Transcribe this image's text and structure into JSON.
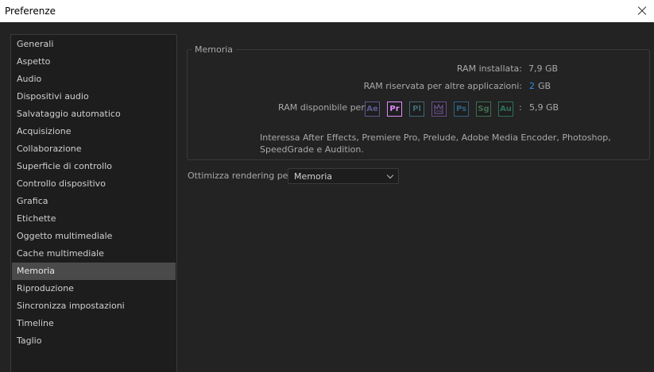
{
  "window": {
    "title": "Preferenze"
  },
  "sidebar": {
    "items": [
      {
        "label": "Generali",
        "active": false
      },
      {
        "label": "Aspetto",
        "active": false
      },
      {
        "label": "Audio",
        "active": false
      },
      {
        "label": "Dispositivi audio",
        "active": false
      },
      {
        "label": "Salvataggio automatico",
        "active": false
      },
      {
        "label": "Acquisizione",
        "active": false
      },
      {
        "label": "Collaborazione",
        "active": false
      },
      {
        "label": "Superficie di controllo",
        "active": false
      },
      {
        "label": "Controllo dispositivo",
        "active": false
      },
      {
        "label": "Grafica",
        "active": false
      },
      {
        "label": "Etichette",
        "active": false
      },
      {
        "label": "Oggetto multimediale",
        "active": false
      },
      {
        "label": "Cache multimediale",
        "active": false
      },
      {
        "label": "Memoria",
        "active": true
      },
      {
        "label": "Riproduzione",
        "active": false
      },
      {
        "label": "Sincronizza impostazioni",
        "active": false
      },
      {
        "label": "Timeline",
        "active": false
      },
      {
        "label": "Taglio",
        "active": false
      }
    ]
  },
  "memory": {
    "group_title": "Memoria",
    "installed_label": "RAM installata:",
    "installed_value": "7,9 GB",
    "reserved_label": "RAM riservata per altre applicazioni:",
    "reserved_value": "2",
    "reserved_unit": "GB",
    "available_label": "RAM disponibile per",
    "available_sep": ":",
    "available_value": "5,9 GB",
    "apps": [
      {
        "abbr": "Ae",
        "icon": "after-effects-icon",
        "color": "#5a5a8c"
      },
      {
        "abbr": "Pr",
        "icon": "premiere-pro-icon",
        "color": "#e18bff"
      },
      {
        "abbr": "Pl",
        "icon": "prelude-icon",
        "color": "#3f6a73"
      },
      {
        "abbr": "",
        "icon": "media-encoder-icon",
        "color": "#6b4f8c"
      },
      {
        "abbr": "Ps",
        "icon": "photoshop-icon",
        "color": "#2f6284"
      },
      {
        "abbr": "Sg",
        "icon": "speedgrade-icon",
        "color": "#3f6e52"
      },
      {
        "abbr": "Au",
        "icon": "audition-icon",
        "color": "#2f6f5b"
      }
    ],
    "description": "Interessa After Effects, Premiere Pro, Prelude, Adobe Media Encoder, Photoshop, SpeedGrade e Audition."
  },
  "rendering": {
    "label": "Ottimizza rendering per:",
    "value": "Memoria"
  }
}
